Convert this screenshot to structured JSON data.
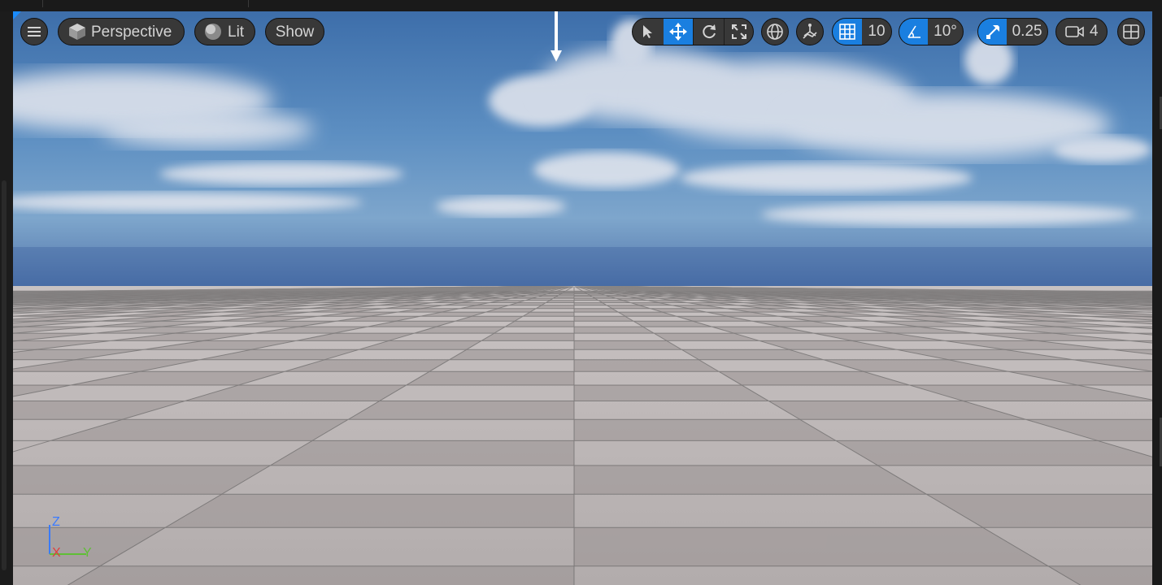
{
  "toolbar": {
    "view_mode_label": "Perspective",
    "lighting_label": "Lit",
    "show_label": "Show",
    "grid_snap_value": "10",
    "rotation_snap_value": "10°",
    "scale_snap_value": "0.25",
    "camera_speed_value": "4"
  },
  "axis_gizmo": {
    "z": "Z",
    "x": "X",
    "y": "Y"
  },
  "colors": {
    "accent": "#1a7fe0",
    "button_bg": "#383838",
    "button_text": "#d4d4d4",
    "axis_x": "#e23c3c",
    "axis_y": "#5fbf35",
    "axis_z": "#3a7bff"
  },
  "icons": [
    "menu-icon",
    "perspective-cube-icon",
    "lit-sphere-icon",
    "select-arrow-icon",
    "translate-icon",
    "rotate-icon",
    "scale-icon",
    "world-space-icon",
    "surface-snap-icon",
    "grid-snap-icon",
    "rotation-snap-icon",
    "scale-snap-icon",
    "camera-speed-icon",
    "layout-icon",
    "sun-direction-arrow"
  ]
}
